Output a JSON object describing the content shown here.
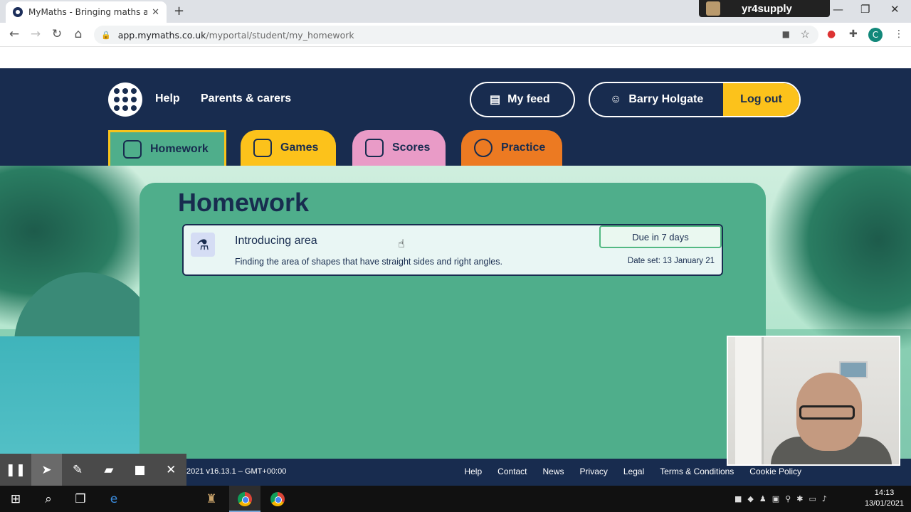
{
  "browser": {
    "tab_title": "MyMaths - Bringing maths alive",
    "tab_close": "✕",
    "new_tab": "+",
    "recorder_label": "yr4supply",
    "url_host": "app.mymaths.co.uk",
    "url_path": "/myportal/student/my_homework",
    "profile_initial": "C"
  },
  "header": {
    "help": "Help",
    "parents": "Parents & carers",
    "my_feed": "My feed",
    "user_name": "Barry Holgate",
    "logout": "Log out"
  },
  "nav_tabs": [
    {
      "label": "Homework",
      "color": "#4fae8b"
    },
    {
      "label": "Games",
      "color": "#fcc21b"
    },
    {
      "label": "Scores",
      "color": "#e99bc7"
    },
    {
      "label": "Practice",
      "color": "#ec7a22"
    }
  ],
  "main": {
    "title": "Homework",
    "homework_item": {
      "title": "Introducing area",
      "description": "Finding the area of shapes that have straight sides and right angles.",
      "due": "Due in 7 days",
      "date_set": "Date set: 13 January 21"
    }
  },
  "footer": {
    "version": "2021  v16.13.1 – GMT+00:00",
    "links": [
      "Help",
      "Contact",
      "News",
      "Privacy",
      "Legal",
      "Terms & Conditions",
      "Cookie Policy"
    ]
  },
  "taskbar": {
    "time": "14:13",
    "date": "13/01/2021"
  },
  "colors": {
    "navy": "#182c4f",
    "yellow": "#fcc21b",
    "green_panel": "#4fae8b"
  }
}
